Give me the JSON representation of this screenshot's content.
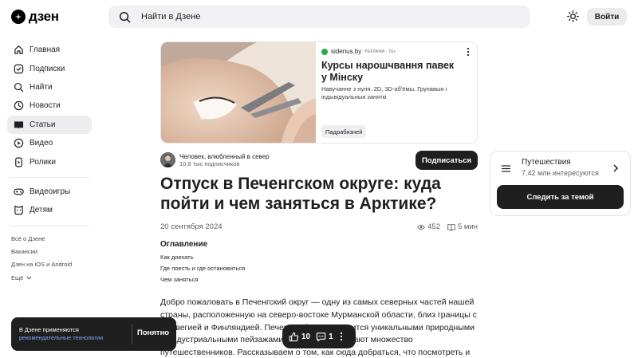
{
  "header": {
    "logo_text": "дзен",
    "search_placeholder": "Найти в Дзене",
    "login_label": "Войти"
  },
  "sidebar": {
    "items": [
      {
        "label": "Главная",
        "icon": "home-icon"
      },
      {
        "label": "Подписки",
        "icon": "subscriptions-icon"
      },
      {
        "label": "Найти",
        "icon": "search-icon"
      },
      {
        "label": "Новости",
        "icon": "news-icon"
      },
      {
        "label": "Статьи",
        "icon": "articles-icon",
        "active": true
      },
      {
        "label": "Видео",
        "icon": "video-icon"
      },
      {
        "label": "Ролики",
        "icon": "shorts-icon"
      }
    ],
    "extra_items": [
      {
        "label": "Видеоигры",
        "icon": "gamepad-icon"
      },
      {
        "label": "Детям",
        "icon": "kids-icon"
      }
    ],
    "footer_links": [
      "Всё о Дзене",
      "Вакансии",
      "Дзен на iOS и Android",
      "Ещё"
    ]
  },
  "ad": {
    "source": "siderius.by",
    "tag": "РЕКЛАМА · 16+",
    "title": "Курсы нарошчвання павек у Мінску",
    "description": "Навучанне з нуля. 2D, 3D-аб'ёмы. Групавыя і індывідуальныя заняткі",
    "cta": "Падрабязней"
  },
  "author": {
    "name": "Человек, влюбленный в север",
    "subscribers": "10,8 тыс подписчиков",
    "subscribe_label": "Подписаться"
  },
  "article": {
    "title": "Отпуск в Печенгском округе: куда пойти и чем заняться в Арктике?",
    "date": "20 сентября 2024",
    "views": "452",
    "read_time": "5 мин",
    "toc_title": "Оглавление",
    "toc": [
      "Как доехать",
      "Где поесть и где остановиться",
      "Чем заняться"
    ],
    "body": "Добро пожаловать в Печенгский округ — одну из самых северных частей нашей страны, расположенную на северо-востоке Мурманской области, близ границы с Норвегией и Финляндией. Печенгский округ славится уникальными природными и индустриальными пейзажами, которые привлекают множество путешественников. Рассказываем о том, как сюда добраться, что посмотреть и где остановиться."
  },
  "topic": {
    "name": "Путешествия",
    "count": "7,42 млн интересуются",
    "follow_label": "Следить за темой"
  },
  "cookie": {
    "text": "В Дзене применяются",
    "link": "рекомендательные технологии",
    "button": "Понятно"
  },
  "reactions": {
    "likes": "10",
    "comments": "1"
  },
  "colors": {
    "dark": "#1f1f1f",
    "active_bg": "#ededf0",
    "link": "#7fa6ff",
    "ad_dot": "#2aa94a"
  }
}
